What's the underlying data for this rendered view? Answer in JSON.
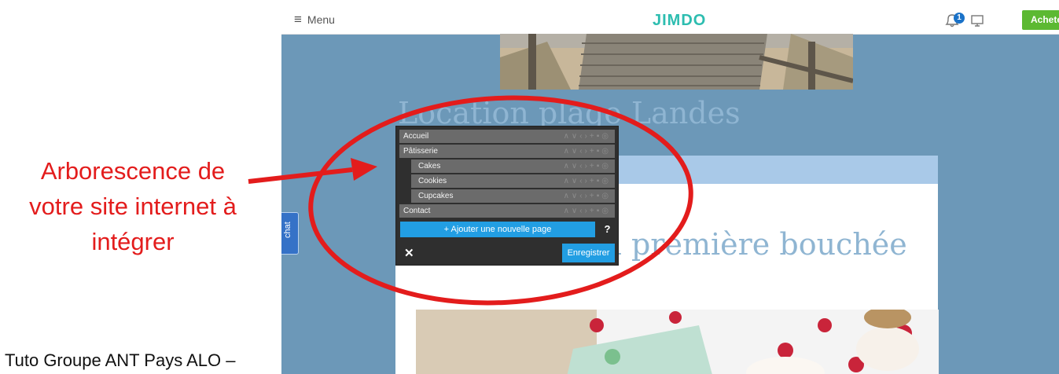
{
  "annotation": {
    "lines": [
      "Arborescence de",
      "votre site internet à",
      "intégrer"
    ],
    "color": "#e31c1c"
  },
  "footer": {
    "text": "Tuto Groupe ANT Pays ALO –"
  },
  "topbar": {
    "menu_icon": "hamburger-icon",
    "menu_label": "Menu",
    "logo": "JIMDO",
    "notification_count": "1",
    "buy_label": "Achete"
  },
  "site": {
    "title": "Location plage Landes",
    "heading": "Fondre dès la première bouchée"
  },
  "chat": {
    "label": "chat"
  },
  "navigator": {
    "pages": [
      {
        "label": "Accueil"
      },
      {
        "label": "Pâtisserie"
      },
      {
        "label": "Cakes"
      },
      {
        "label": "Cookies"
      },
      {
        "label": "Cupcakes"
      },
      {
        "label": "Contact"
      }
    ],
    "add_page_label": "+ Ajouter une nouvelle page",
    "help_label": "?",
    "close_label": "✕",
    "save_label": "Enregistrer"
  },
  "colors": {
    "page_background": "#6c98b8",
    "accent_blue": "#229ee3",
    "buy_green": "#5cb932",
    "highlight_red": "#e31c1c"
  }
}
